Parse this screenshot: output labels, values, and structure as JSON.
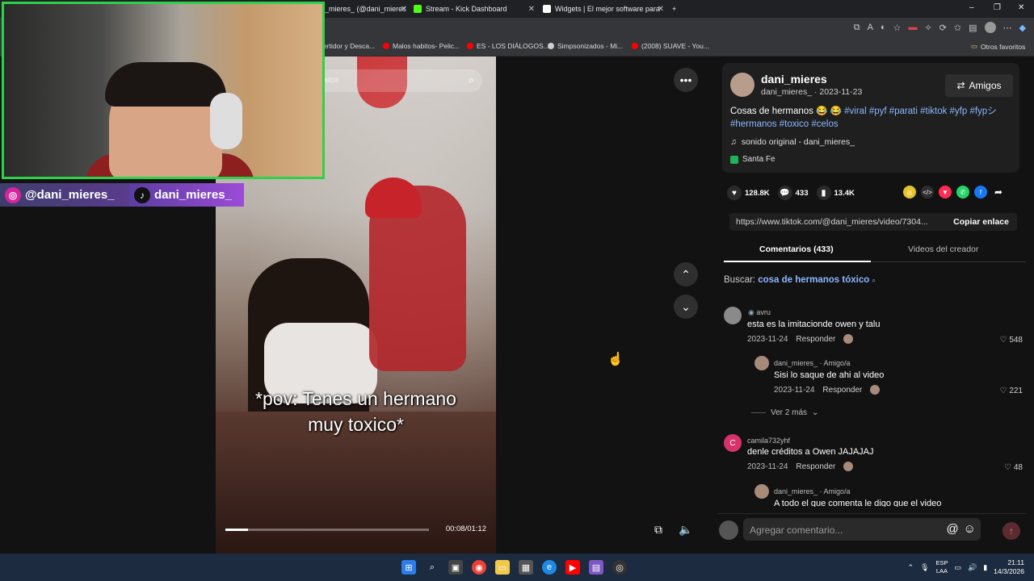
{
  "browser": {
    "tabs": [
      {
        "label": "_mieres_ (@dani_mieres",
        "color": "#69c9d0"
      },
      {
        "label": "Stream - Kick Dashboard",
        "color": "#53fc18"
      },
      {
        "label": "Widgets | El mejor software para",
        "color": "#ffffff"
      }
    ],
    "bookmarks": [
      {
        "label": "ertidor y Desca...",
        "color": "#7a7a7a"
      },
      {
        "label": "Malos habitos- Pelic...",
        "color": "#ff0000"
      },
      {
        "label": "ES - LOS DIÁLOGOS...",
        "color": "#ff0000"
      },
      {
        "label": "Simpsonizados - Mi...",
        "color": "#cfcfcf"
      },
      {
        "label": "(2008) SUAVE - You...",
        "color": "#ff0000"
      }
    ],
    "other_favorites": "Otros favoritos"
  },
  "stream_overlay": {
    "instagram_handle": "@dani_mieres_",
    "tiktok_handle": "dani_mieres_"
  },
  "video": {
    "search_placeholder": "xico",
    "caption_line1": "*pov: Tenes un hermano",
    "caption_line2": "muy toxico*",
    "time": "00:08/01:12",
    "progress": 0.11
  },
  "post": {
    "author": "dani_mieres",
    "author_sub": "dani_mieres_ · 2023-11-23",
    "friends_label": "Amigos",
    "description": "Cosas de hermanos 😂 😂 ",
    "hashtags": "#viral #pyf #parati #tiktok #yfp #fypシ #hermanos #toxico #celos",
    "music": "sonido original - dani_mieres_",
    "location": "Santa Fe"
  },
  "stats": {
    "likes": "128.8K",
    "comments": "433",
    "saves": "13.4K"
  },
  "link": {
    "url": "https://www.tiktok.com/@dani_mieres/video/7304...",
    "copy_label": "Copiar enlace"
  },
  "tabs": {
    "comments": "Comentarios (433)",
    "creator_videos": "Videos del creador"
  },
  "search": {
    "prefix": "Buscar:",
    "query": "cosa de hermanos tóxico"
  },
  "comments": [
    {
      "user": "avru",
      "text": "esta es la imitacionde owen y talu",
      "date": "2023-11-24",
      "reply": "Responder",
      "likes": "548"
    },
    {
      "user": "dani_mieres_ · Amigo/a",
      "text": "Sisi lo saque de ahi al video",
      "date": "2023-11-24",
      "reply": "Responder",
      "likes": "221"
    },
    {
      "user": "camila732yhf",
      "text": "denle créditos a Owen JAJAJAJ",
      "date": "2023-11-24",
      "reply": "Responder",
      "likes": "48"
    },
    {
      "user": "dani_mieres_ · Amigo/a",
      "text": "A todo el que comenta le digo que el video",
      "date": "",
      "reply": "",
      "likes": ""
    }
  ],
  "more_replies": "Ver 2 más",
  "comment_input": {
    "placeholder": "Agregar comentario..."
  },
  "taskbar": {
    "lang_line1": "ESP",
    "lang_line2": "LAA",
    "time": "21:11",
    "date": "14/3/2026"
  }
}
